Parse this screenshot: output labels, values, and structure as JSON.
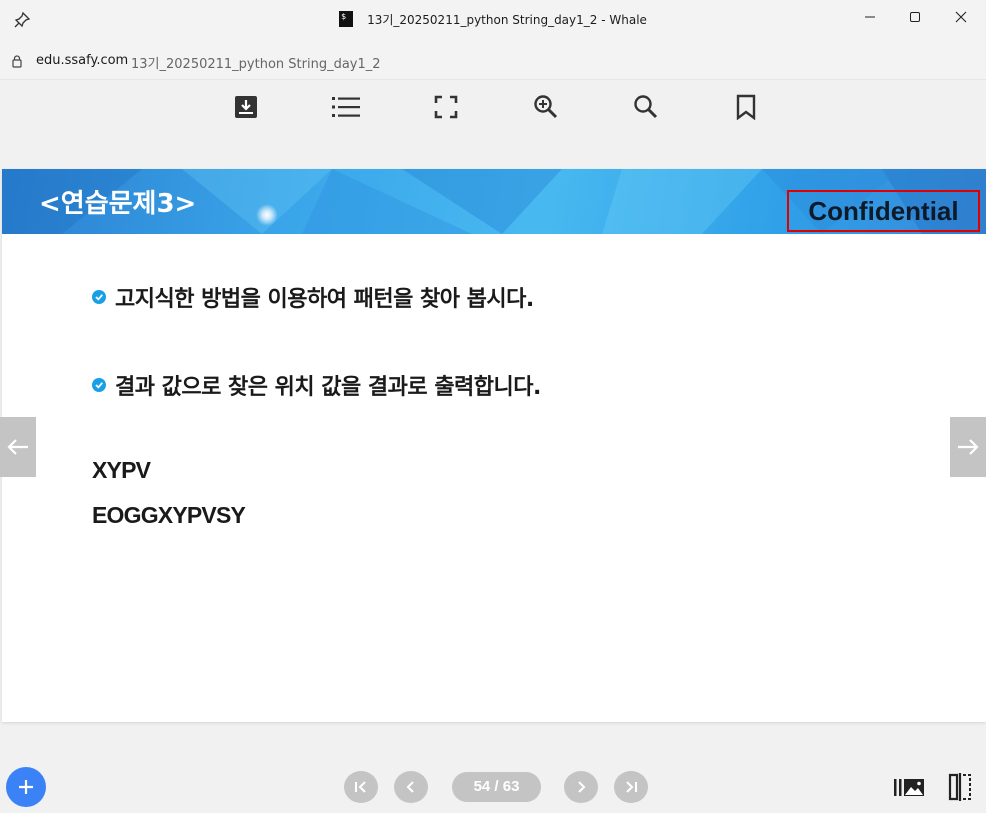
{
  "window": {
    "title": "13기_20250211_python String_day1_2 - Whale",
    "controls": [
      "minimize",
      "maximize",
      "close"
    ]
  },
  "address_bar": {
    "domain": "edu.ssafy.com",
    "path": "13기_20250211_python String_day1_2"
  },
  "toolbar": {
    "icons": [
      "download-icon",
      "list-icon",
      "fullscreen-icon",
      "zoom-in-icon",
      "search-icon",
      "bookmark-icon"
    ]
  },
  "slide": {
    "title": "<연습문제3>",
    "badge": "Confidential",
    "bullets": [
      "고지식한 방법을 이용하여 패턴을 찾아 봅시다.",
      "결과 값으로 찾은 위치 값을 결과로 출력합니다."
    ],
    "pattern": "XYPV",
    "text": "EOGGXYPVSY"
  },
  "pager": {
    "current": "54",
    "total": "63",
    "label": "54 / 63"
  },
  "colors": {
    "header_blue": "#3aa6ea",
    "check_blue": "#18a0e6",
    "confidential_border": "#e00000",
    "fab_blue": "#3b82f6",
    "nav_gray": "#c4c4c4"
  }
}
